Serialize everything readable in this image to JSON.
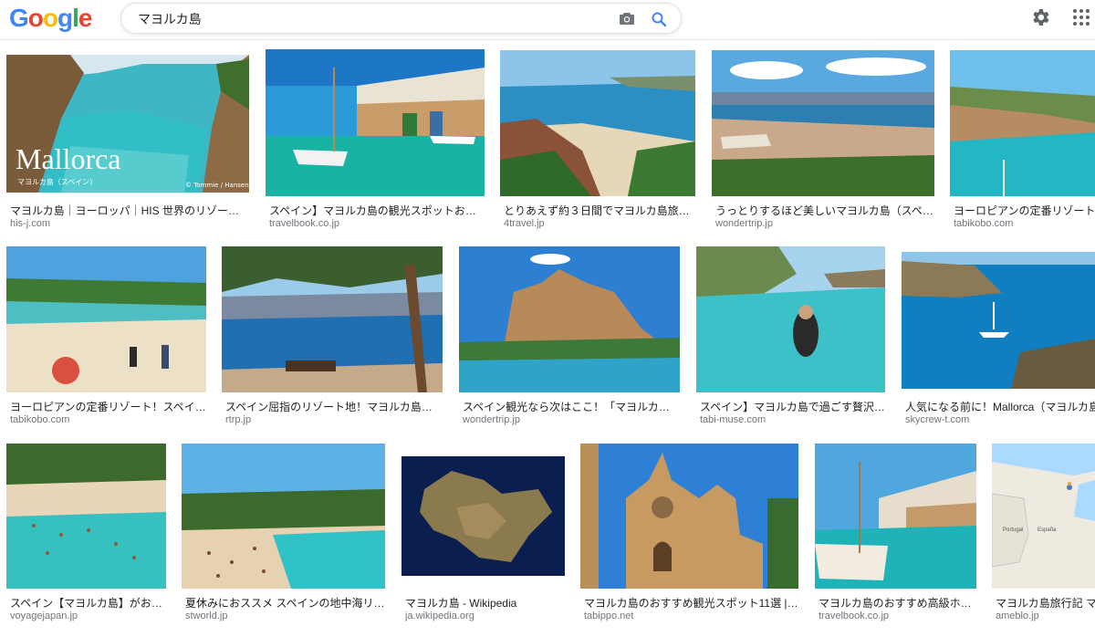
{
  "header": {
    "logo": [
      "G",
      "o",
      "o",
      "g",
      "l",
      "e"
    ],
    "logo_colors": [
      "#4285F4",
      "#EA4335",
      "#FBBC05",
      "#4285F4",
      "#34A853",
      "#EA4335"
    ],
    "search_value": "マヨルカ島"
  },
  "results": [
    {
      "caption": "マヨルカ島｜ヨーロッパ｜HIS 世界のリゾート特集",
      "domain": "his-j.com",
      "overlay_title": "Mallorca",
      "overlay_sub": "マヨルカ島（スペイン）",
      "overlay_credit": "© Tommie / Hansen"
    },
    {
      "caption": "スペイン】マヨルカ島の観光スポットおすす…",
      "domain": "travelbook.co.jp"
    },
    {
      "caption": "とりあえず約３日間でマヨルカ島旅行を…",
      "domain": "4travel.jp"
    },
    {
      "caption": "うっとりするほど美しいマヨルカ島（スペイン…",
      "domain": "wondertrip.jp"
    },
    {
      "caption": "ヨーロピアンの定番リゾート！ス",
      "domain": "tabikobo.com"
    },
    {
      "caption": "ヨーロピアンの定番リゾート！スペイン…",
      "domain": "tabikobo.com"
    },
    {
      "caption": "スペイン屈指のリゾート地！マヨルカ島のおす…",
      "domain": "rtrp.jp"
    },
    {
      "caption": "スペイン観光なら次はここ！「マヨルカ島」で…",
      "domain": "wondertrip.jp"
    },
    {
      "caption": "スペイン】マヨルカ島で過ごす贅沢バ…",
      "domain": "tabi-muse.com"
    },
    {
      "caption": "人気になる前に！Mallorca（マヨルカ島）へ",
      "domain": "skycrew-t.com"
    },
    {
      "caption": "スペイン【マヨルカ島】がおす…",
      "domain": "voyagejapan.jp"
    },
    {
      "caption": "夏休みにおススメ スペインの地中海リゾー…",
      "domain": "stworld.jp"
    },
    {
      "caption": "マヨルカ島 - Wikipedia",
      "domain": "ja.wikipedia.org"
    },
    {
      "caption": "マヨルカ島のおすすめ観光スポット11選 | TAB…",
      "domain": "tabippo.net"
    },
    {
      "caption": "マヨルカ島のおすすめ高級ホテル…",
      "domain": "travelbook.co.jp"
    },
    {
      "caption": "マヨルカ島旅行記 マ",
      "domain": "ameblo.jp",
      "map_labels": [
        "Portugal",
        "España"
      ]
    }
  ]
}
